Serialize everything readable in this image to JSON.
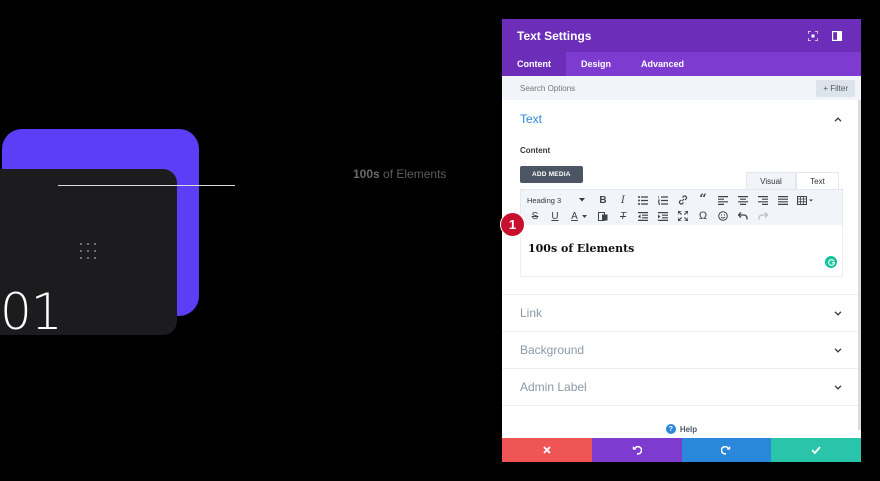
{
  "preview": {
    "number": "01",
    "text_bold": "100s",
    "text_rest": " of Elements"
  },
  "modal": {
    "title": "Text Settings",
    "tabs": [
      {
        "label": "Content",
        "active": true
      },
      {
        "label": "Design",
        "active": false
      },
      {
        "label": "Advanced",
        "active": false
      }
    ],
    "search_placeholder": "Search Options",
    "filter_label": "Filter",
    "text_section": {
      "title": "Text",
      "content_label": "Content",
      "add_media_label": "ADD MEDIA",
      "mode_visual": "Visual",
      "mode_text": "Text",
      "format_select": "Heading 3",
      "editor_content": "100s of Elements"
    },
    "sections": [
      {
        "title": "Link"
      },
      {
        "title": "Background"
      },
      {
        "title": "Admin Label"
      }
    ],
    "help_label": "Help"
  },
  "badge": "1",
  "colors": {
    "header": "#6c2eb9",
    "tabs": "#7e3bd0",
    "accent_blue": "#2b87da",
    "cancel": "#ef5555",
    "undo": "#7e3bd0",
    "redo": "#2b87da",
    "save": "#29c4a9",
    "card_purple": "#5b3ef6"
  }
}
